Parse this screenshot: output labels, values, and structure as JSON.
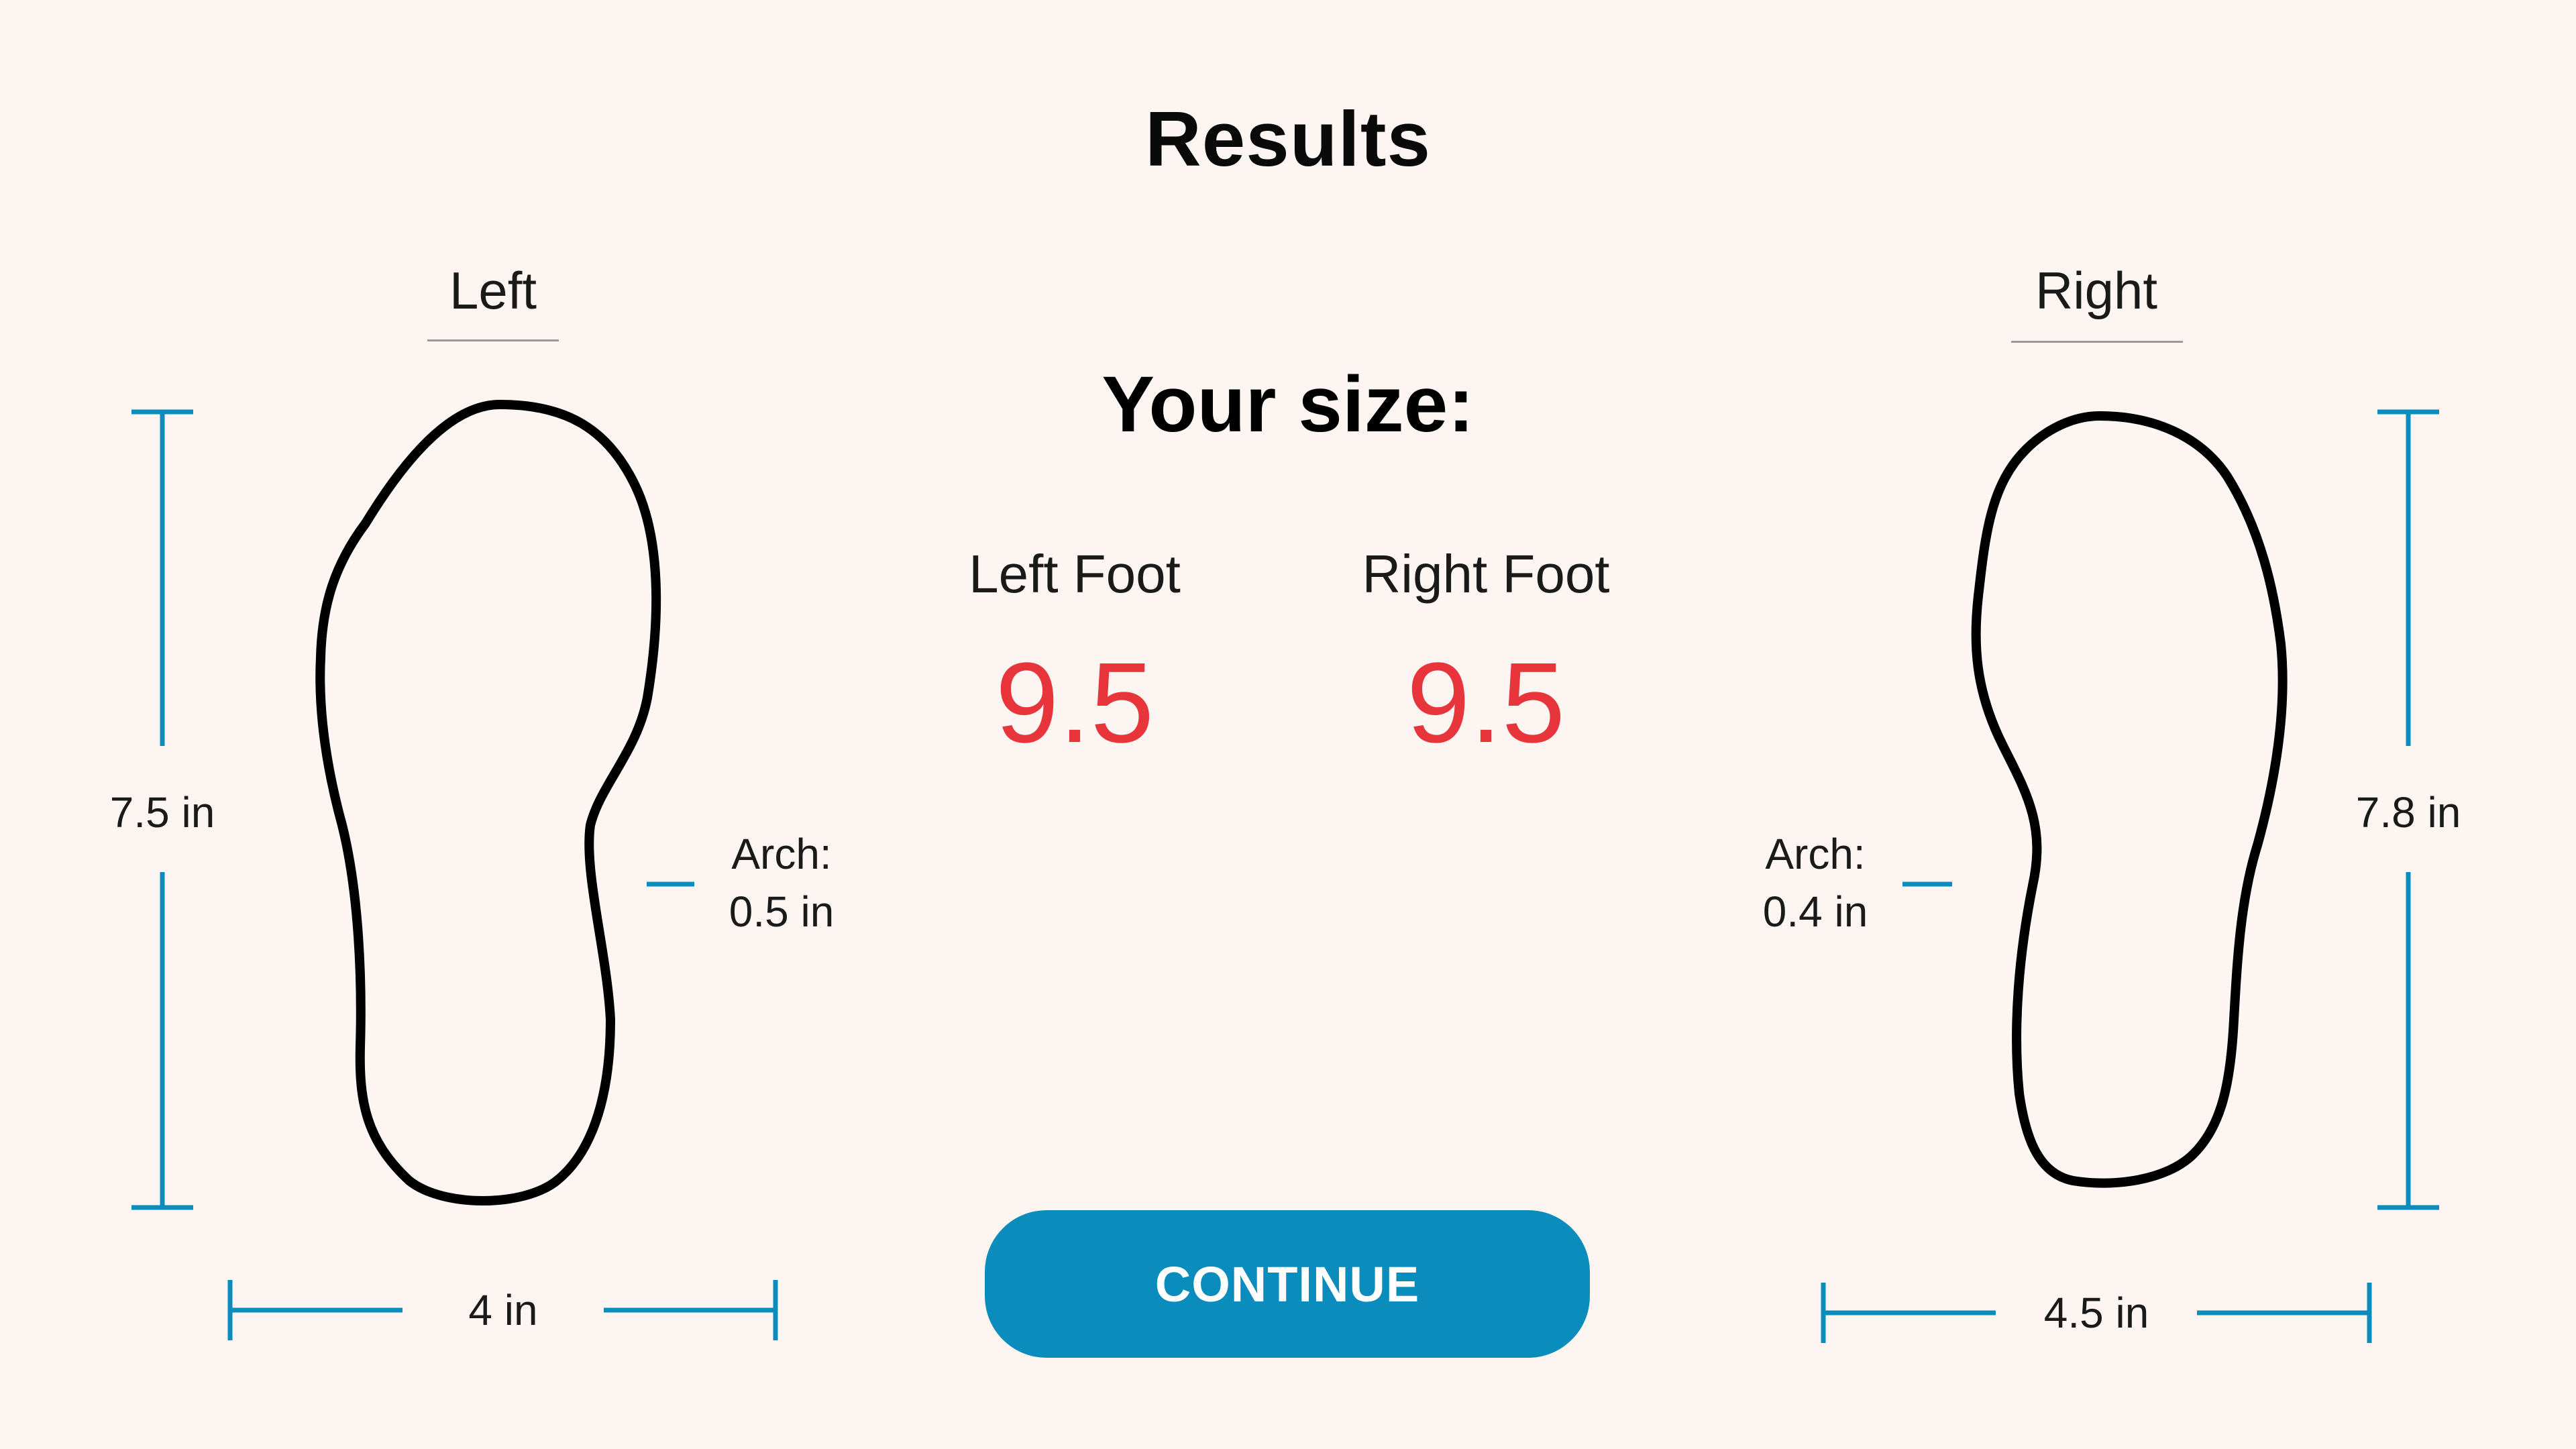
{
  "page": {
    "title": "Results",
    "size_heading": "Your size:",
    "continue_label": "CONTINUE"
  },
  "left": {
    "label": "Left",
    "foot_label": "Left Foot",
    "size": "9.5",
    "length": "7.5 in",
    "width": "4 in",
    "arch_label": "Arch:",
    "arch_value": "0.5 in"
  },
  "right": {
    "label": "Right",
    "foot_label": "Right Foot",
    "size": "9.5",
    "length": "7.8 in",
    "width": "4.5 in",
    "arch_label": "Arch:",
    "arch_value": "0.4 in"
  },
  "colors": {
    "background": "#fcf5f1",
    "accent": "#0a8cbd",
    "size_value": "#e8353b",
    "outline": "#000000"
  }
}
